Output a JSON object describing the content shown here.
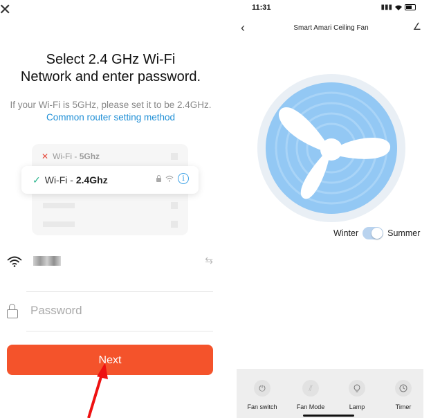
{
  "left": {
    "title_line1": "Select 2.4 GHz Wi-Fi",
    "title_line2": "Network and enter password.",
    "subtitle_text": "If your Wi-Fi is 5GHz, please set it to be 2.4GHz.",
    "subtitle_link": "Common router setting method",
    "networks": {
      "rejected_prefix": "Wi-Fi - ",
      "rejected_band": "5Ghz",
      "selected_prefix": "Wi-Fi - ",
      "selected_band": "2.4Ghz"
    },
    "password_placeholder": "Password",
    "next_label": "Next",
    "colors": {
      "primary": "#f4532b",
      "link": "#1f8fd6",
      "check": "#28b48c",
      "error": "#e64a3c"
    }
  },
  "right": {
    "status_time": "11:31",
    "nav_title": "Smart Amari Ceiling Fan",
    "season_left": "Winter",
    "season_right": "Summer",
    "controls": [
      {
        "label": "Fan switch",
        "icon": "power-icon"
      },
      {
        "label": "Fan Mode",
        "icon": "fan-mode-icon"
      },
      {
        "label": "Lamp",
        "icon": "lamp-icon"
      },
      {
        "label": "Timer",
        "icon": "timer-icon"
      }
    ],
    "colors": {
      "fan_blue": "#8fc6f3",
      "fan_ring": "#e9eff5"
    }
  }
}
